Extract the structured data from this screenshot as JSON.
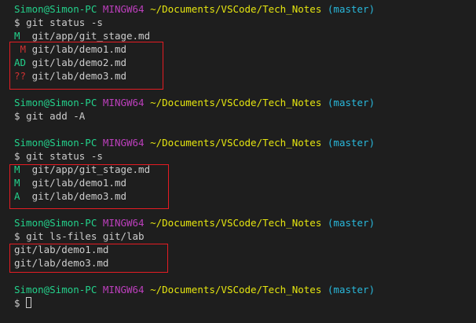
{
  "colors": {
    "background": "#1e1e1e",
    "text": "#cccccc",
    "user": "#23d18b",
    "host": "#bc3fbc",
    "path": "#e5e510",
    "branch": "#29b8db",
    "status_green": "#23d18b",
    "status_red": "#cd3131",
    "highlight_box": "#e51c23"
  },
  "prompt": {
    "user_host": "Simon@Simon-PC",
    "shell": "MINGW64",
    "path": "~/Documents/VSCode/Tech_Notes",
    "branch": "(master)",
    "symbol": "$"
  },
  "block1": {
    "command": "git status -s",
    "entries": [
      {
        "code": "M ",
        "file": "git/app/git_stage.md"
      },
      {
        "code": " M",
        "file": "git/lab/demo1.md"
      },
      {
        "code": "AD",
        "file": "git/lab/demo2.md"
      },
      {
        "code": "??",
        "file": "git/lab/demo3.md"
      }
    ]
  },
  "block2": {
    "command": "git add -A"
  },
  "block3": {
    "command": "git status -s",
    "entries": [
      {
        "code": "M ",
        "file": "git/app/git_stage.md"
      },
      {
        "code": "M ",
        "file": "git/lab/demo1.md"
      },
      {
        "code": "A ",
        "file": "git/lab/demo3.md"
      }
    ]
  },
  "block4": {
    "command": "git ls-files git/lab",
    "output": [
      "git/lab/demo1.md",
      "git/lab/demo3.md"
    ]
  }
}
